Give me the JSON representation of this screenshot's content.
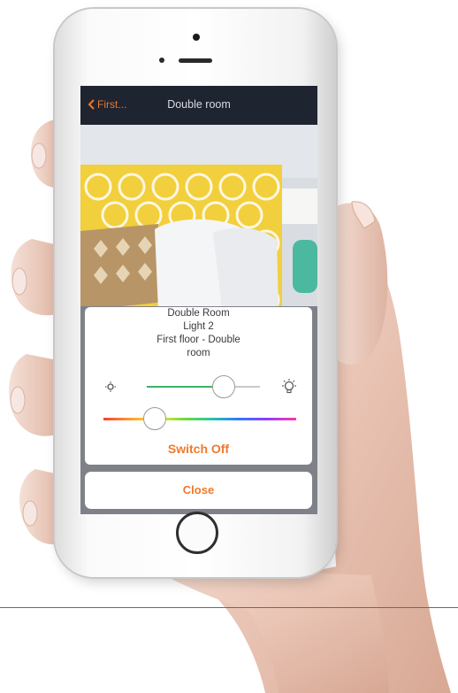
{
  "navbar": {
    "back_label": "First...",
    "title": "Double room"
  },
  "light_card": {
    "room": "Double Room",
    "device": "Light 2",
    "location_line1": "First floor - Double",
    "location_line2": "room",
    "brightness_level": 0.68,
    "hue_position": 0.27,
    "switch_label": "Switch Off"
  },
  "close_label": "Close",
  "colors": {
    "accent": "#f07a2b",
    "navbar": "#1f2431",
    "slider_green": "#3cb36a"
  }
}
